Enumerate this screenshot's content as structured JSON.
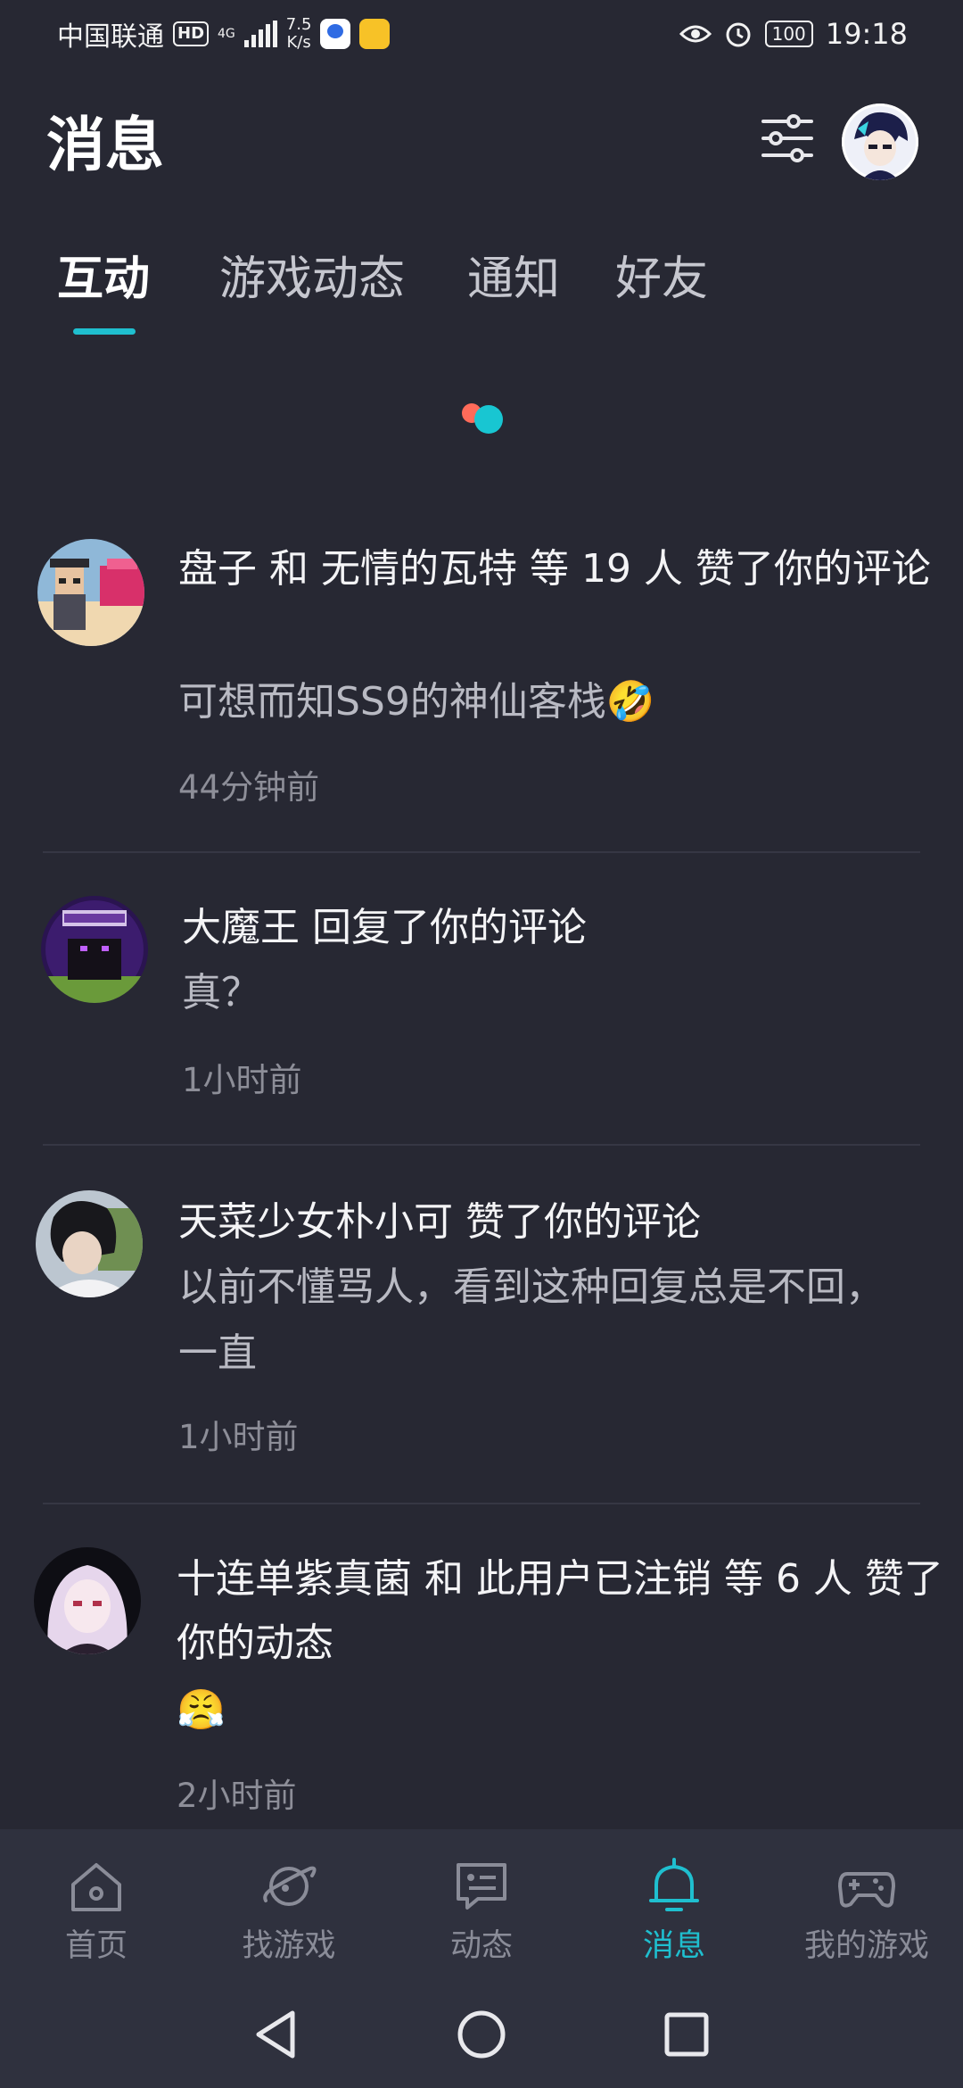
{
  "status_bar": {
    "carrier": "中国联通",
    "hd": "HD",
    "signal_type": "4G",
    "speed_value": "7.5",
    "speed_unit": "K/s",
    "battery": "100",
    "time": "19:18"
  },
  "header": {
    "title": "消息"
  },
  "tabs": [
    {
      "label": "互动",
      "active": true
    },
    {
      "label": "游戏动态",
      "active": false
    },
    {
      "label": "通知",
      "active": false
    },
    {
      "label": "好友",
      "active": false
    }
  ],
  "messages": [
    {
      "title": "盘子 和 无情的瓦特 等 19 人 赞了你的评论",
      "body": "可想而知SS9的神仙客栈🤣",
      "time": "44分钟前"
    },
    {
      "title": "大魔王 回复了你的评论",
      "body": "真？",
      "time": "1小时前"
    },
    {
      "title": "天菜少女朴小可 赞了你的评论",
      "body": "以前不懂骂人，看到这种回复总是不回，一直",
      "time": "1小时前"
    },
    {
      "title": "十连单紫真菌 和 此用户已注销 等 6 人 赞了你的动态",
      "body": "😤",
      "time": "2小时前"
    }
  ],
  "bottom_nav": [
    {
      "label": "首页",
      "icon": "home-icon",
      "active": false
    },
    {
      "label": "找游戏",
      "icon": "planet-icon",
      "active": false
    },
    {
      "label": "动态",
      "icon": "chat-bubble-icon",
      "active": false
    },
    {
      "label": "消息",
      "icon": "bell-icon",
      "active": true
    },
    {
      "label": "我的游戏",
      "icon": "gamepad-icon",
      "active": false
    }
  ],
  "colors": {
    "background": "#272833",
    "accent": "#1fbfcf",
    "nav_background": "#2f313e"
  }
}
